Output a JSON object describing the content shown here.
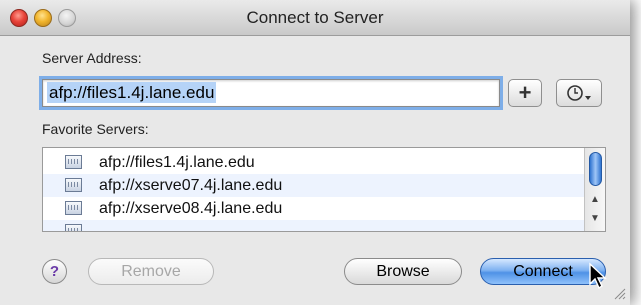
{
  "window": {
    "title": "Connect to Server"
  },
  "server_address": {
    "label": "Server Address:",
    "value": "afp://files1.4j.lane.edu",
    "add_button": "+",
    "recent_icon": "clock-menu-icon"
  },
  "favorites": {
    "label": "Favorite Servers:",
    "items": [
      {
        "label": "afp://files1.4j.lane.edu",
        "icon": "server-icon"
      },
      {
        "label": "afp://xserve07.4j.lane.edu",
        "icon": "server-icon"
      },
      {
        "label": "afp://xserve08.4j.lane.edu",
        "icon": "server-icon"
      }
    ]
  },
  "buttons": {
    "help": "?",
    "remove": "Remove",
    "browse": "Browse",
    "connect": "Connect"
  },
  "colors": {
    "accent": "#4f92e6",
    "focus_ring": "#7eaee8",
    "selection": "#b5d3f7",
    "alt_row": "#edf3fe",
    "window_bg": "#e8e8e8"
  }
}
